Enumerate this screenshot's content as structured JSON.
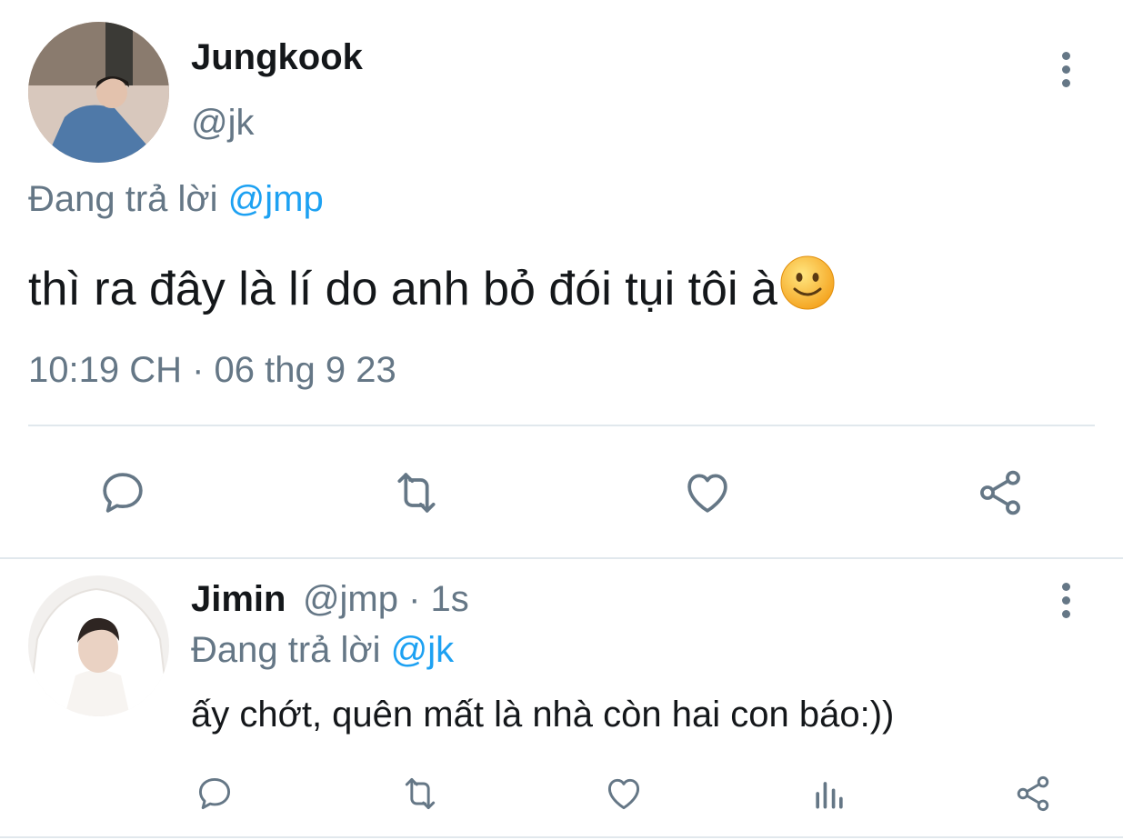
{
  "main_tweet": {
    "author_name": "Jungkook",
    "handle": "@jk",
    "reply_prefix": "Đang trả lời",
    "reply_to": "@jmp",
    "text": "thì ra đây là lí do anh bỏ đói tụi tôi à",
    "timestamp": "10:19 CH · 06 thg 9 23",
    "icons": [
      "reply-icon",
      "retweet-icon",
      "like-icon",
      "share-icon",
      "more-icon"
    ]
  },
  "reply_tweet": {
    "author_name": "Jimin",
    "handle_time": "@jmp · 1s",
    "reply_prefix": "Đang trả lời",
    "reply_to": "@jk",
    "text": "ấy chớt, quên mất là nhà còn hai con báo:))",
    "icons": [
      "reply-icon",
      "retweet-icon",
      "like-icon",
      "analytics-icon",
      "share-icon",
      "more-icon"
    ]
  },
  "colors": {
    "text": "#14171a",
    "muted": "#657786",
    "link": "#1da1f2",
    "divider": "#e1e8ed"
  }
}
